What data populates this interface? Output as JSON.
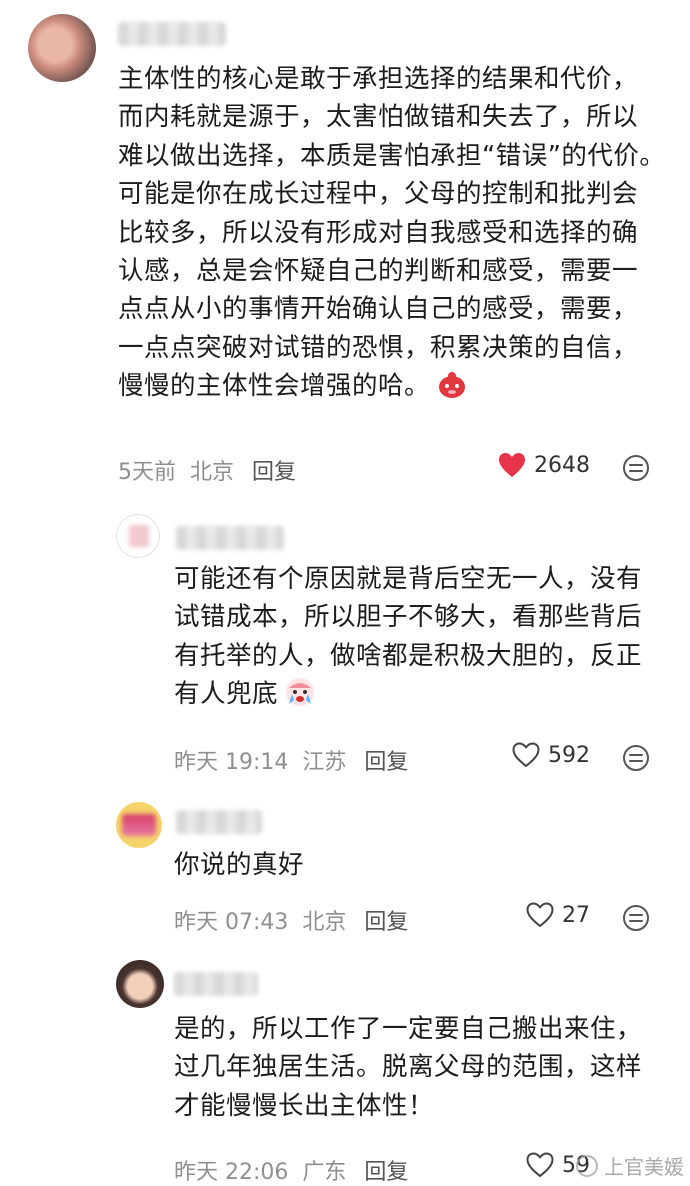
{
  "comments": [
    {
      "lines": [
        "主体性的核心是敢于承担选择的结果和代价，",
        "而内耗就是源于，太害怕做错和失去了，所以",
        "难以做出选择，本质是害怕承担“错误”的代价。",
        "可能是你在成长过程中，父母的控制和批判会",
        "比较多，所以没有形成对自我感受和选择的确",
        "认感，总是会怀疑自己的判断和感受，需要一",
        "点点从小的事情开始确认自己的感受，需要，",
        "一点点突破对试错的恐惧，积累决策的自信，",
        "慢慢的主体性会增强的哈。"
      ],
      "time": "5天前",
      "location": "北京",
      "reply": "回复",
      "likes": "2648",
      "liked": true,
      "emoji": "red-blob-emoji"
    },
    {
      "lines": [
        "可能还有个原因就是背后空无一人，没有",
        "试错成本，所以胆子不够大，看那些背后",
        "有托举的人，做啥都是积极大胆的，反正",
        "有人兜底"
      ],
      "time": "昨天 19:14",
      "location": "江苏",
      "reply": "回复",
      "likes": "592",
      "liked": false,
      "emoji": "crying-emoji"
    },
    {
      "lines": [
        "你说的真好"
      ],
      "time": "昨天 07:43",
      "location": "北京",
      "reply": "回复",
      "likes": "27",
      "liked": false
    },
    {
      "lines": [
        "是的，所以工作了一定要自己搬出来住，",
        "过几年独居生活。脱离父母的范围，这样",
        "才能慢慢长出主体性！"
      ],
      "time": "昨天 22:06",
      "location": "广东",
      "reply": "回复",
      "likes": "59",
      "liked": false
    }
  ],
  "colors": {
    "like_red": "#e8344a",
    "meta_gray": "#8f8f8f",
    "icon_gray": "#555555"
  },
  "watermark": {
    "text": "上官美媛",
    "icon": "weibo-icon"
  }
}
